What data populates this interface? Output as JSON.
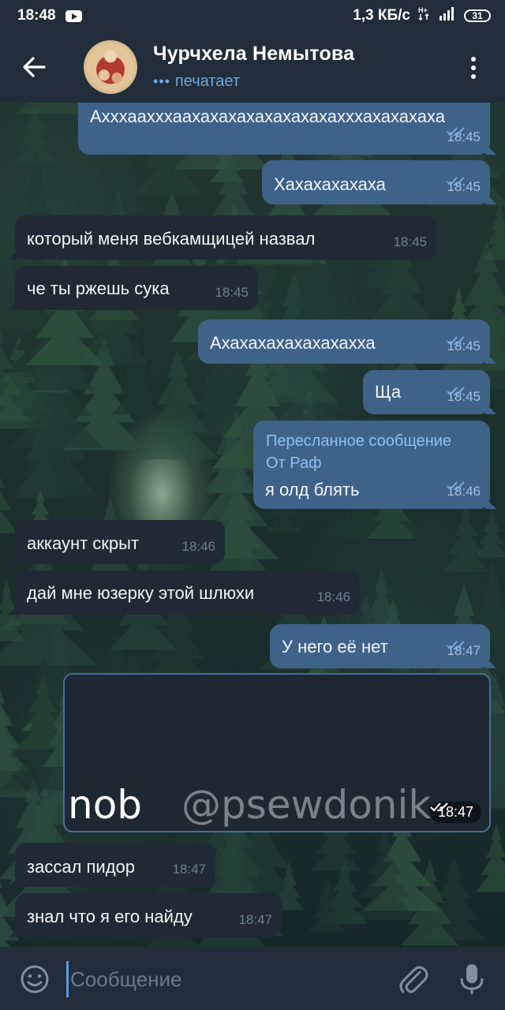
{
  "status_bar": {
    "time": "18:48",
    "speed": "1,3 КБ/с",
    "network": "H+",
    "battery": "31"
  },
  "header": {
    "title": "Чурчхела Немытова",
    "status": "печатает"
  },
  "messages": [
    {
      "dir": "out",
      "text": "Ахххаахххаахахахахахахахахахххахахахаха",
      "time": "18:45"
    },
    {
      "dir": "out",
      "text": "Хахахахахаха",
      "time": "18:45"
    },
    {
      "dir": "in",
      "text": "который меня вебкамщицей назвал",
      "time": "18:45"
    },
    {
      "dir": "in",
      "text": "че ты ржешь сука",
      "time": "18:45"
    },
    {
      "dir": "out",
      "text": "Ахахахахахахахахха",
      "time": "18:45"
    },
    {
      "dir": "out",
      "text": "Ща",
      "time": "18:45"
    },
    {
      "dir": "out",
      "forwarded_title": "Пересланное сообщение",
      "forwarded_from": "От Раф",
      "text": "я олд блять",
      "time": "18:46"
    },
    {
      "dir": "in",
      "text": "аккаунт скрыт",
      "time": "18:46"
    },
    {
      "dir": "in",
      "text": "дай мне юзерку этой шлюхи",
      "time": "18:46"
    },
    {
      "dir": "out",
      "text": "У него её нет",
      "time": "18:47"
    },
    {
      "dir": "out",
      "type": "media",
      "watermark_left": "nob",
      "watermark_handle": "@psewdonik",
      "time": "18:47"
    },
    {
      "dir": "in",
      "text": "зассал пидор",
      "time": "18:47"
    },
    {
      "dir": "in",
      "text": "знал что я его найду",
      "time": "18:47"
    }
  ],
  "input": {
    "placeholder": "Сообщение"
  },
  "icons": {
    "back": "arrow-left-icon",
    "menu": "more-vertical-icon",
    "emoji": "smile-icon",
    "attach": "paperclip-icon",
    "mic": "microphone-icon",
    "read": "double-check-icon"
  },
  "colors": {
    "header_bg": "#212d3b",
    "outgoing_bubble": "#3f6289",
    "incoming_bubble": "#1f2a36",
    "accent": "#71a7e0",
    "forward_text": "#8fc0f4"
  }
}
